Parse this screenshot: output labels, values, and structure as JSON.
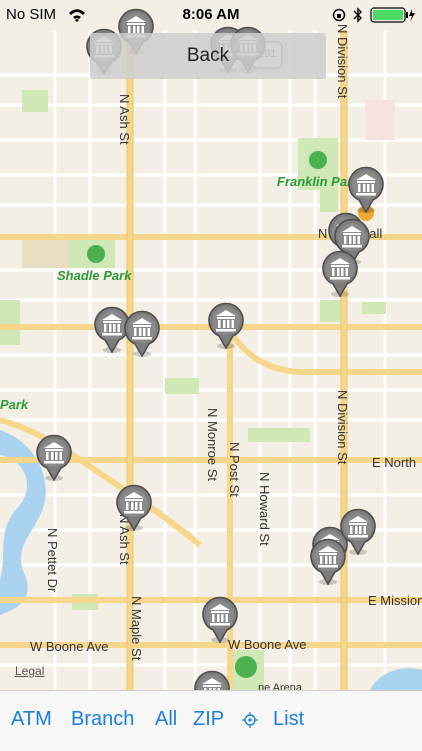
{
  "status_bar": {
    "carrier": "No SIM",
    "time": "8:06 AM"
  },
  "back_button": {
    "label": "Back"
  },
  "map": {
    "legal_label": "Legal",
    "highway_shield": "291",
    "parks": [
      "Franklin Park",
      "Shadle Park",
      "Park"
    ],
    "street_labels": {
      "n_ash_st_top": "N Ash St",
      "n_ash_st_bottom": "N Ash St",
      "n_division_st_top": "N Division St",
      "n_division_st_mid": "N Division St",
      "n_monroe_st": "N Monroe St",
      "n_post_st": "N Post St",
      "n_howard_st": "N Howard St",
      "n_maple_st": "N Maple St",
      "n_pettet_dr": "N Pettet Dr",
      "e_north": "E North",
      "e_mission": "E Mission",
      "w_boone_ave_left": "W Boone Ave",
      "w_boone_ave_right": "W Boone Ave",
      "mall": "N   own Mall",
      "arena": "   ne Arena"
    },
    "pins": [
      "bank-icon",
      "bank-icon",
      "bank-icon",
      "bank-icon",
      "bank-icon",
      "bank-icon",
      "bank-icon",
      "bank-icon",
      "bank-icon",
      "bank-icon",
      "bank-icon",
      "bank-icon",
      "bank-icon",
      "bank-icon",
      "bank-icon",
      "bank-icon",
      "bank-icon"
    ]
  },
  "toolbar": {
    "atm": "ATM",
    "branch": "Branch",
    "all": "All",
    "zip": "ZIP",
    "location_icon": "location-target-icon",
    "list": "List"
  },
  "colors": {
    "accent": "#1a7fe0",
    "map_background": "#f3efe4",
    "park_green": "#cfe8b5",
    "road_yellow": "#f6d68a",
    "water_blue": "#a9d2ee"
  }
}
